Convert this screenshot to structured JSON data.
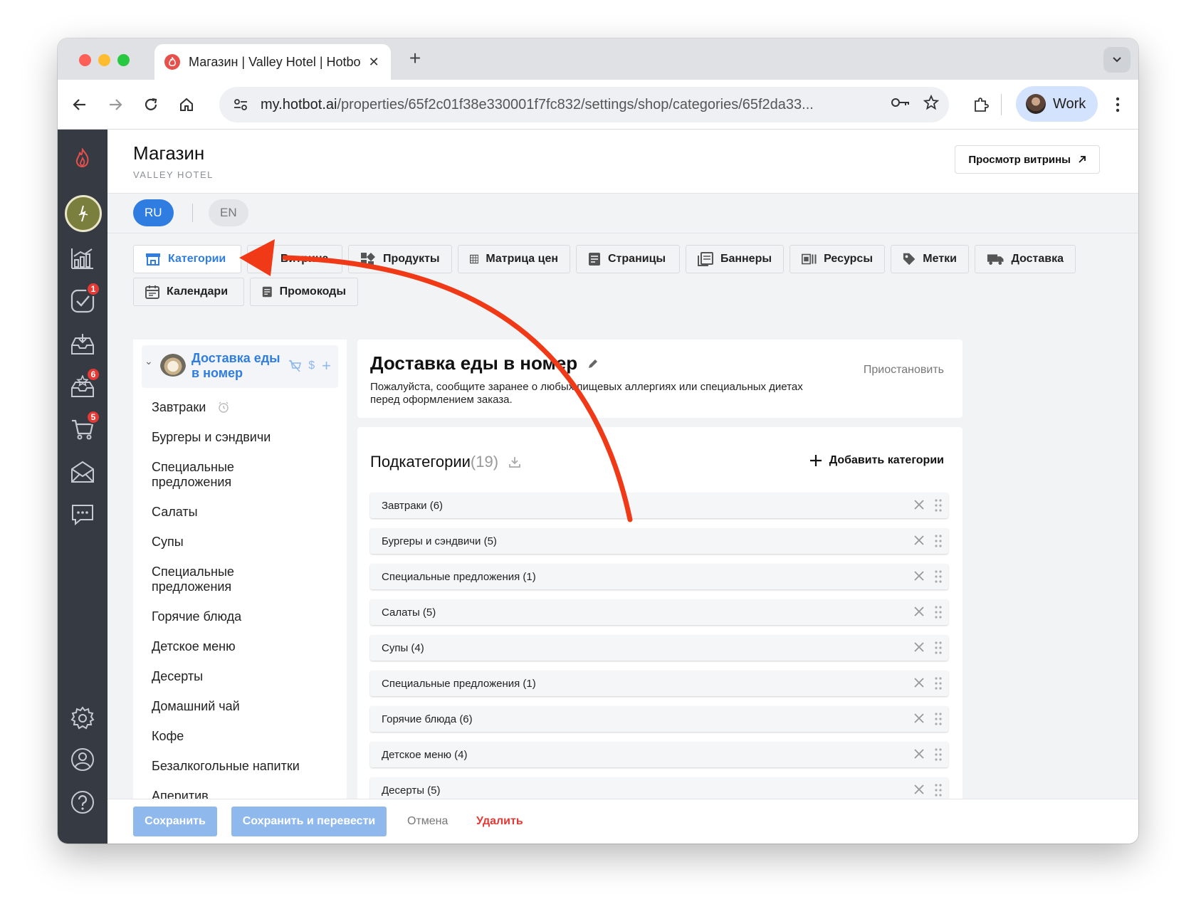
{
  "browser": {
    "tab_title": "Магазин | Valley Hotel | Hotbot",
    "url_host": "my.hotbot.ai",
    "url_path": "/properties/65f2c01f38e330001f7fc832/settings/shop/categories/65f2da33...",
    "profile_name": "Work"
  },
  "sidebar": {
    "badges": {
      "tasks": "1",
      "reviews": "6",
      "cart": "5"
    }
  },
  "header": {
    "title": "Магазин",
    "subtitle": "VALLEY HOTEL",
    "preview_label": "Просмотр витрины"
  },
  "languages": {
    "ru": "RU",
    "en": "EN"
  },
  "nav_tabs": [
    {
      "label": "Категории"
    },
    {
      "label": "Витрина"
    },
    {
      "label": "Продукты"
    },
    {
      "label": "Матрица цен"
    },
    {
      "label": "Страницы"
    },
    {
      "label": "Баннеры"
    },
    {
      "label": "Ресурсы"
    },
    {
      "label": "Метки"
    },
    {
      "label": "Доставка"
    },
    {
      "label": "Календари"
    },
    {
      "label": "Промокоды"
    }
  ],
  "tree": {
    "root_label": "Доставка еды в номер",
    "items": [
      "Завтраки",
      "Бургеры и сэндвичи",
      "Специальные предложения",
      "Салаты",
      "Супы",
      "Специальные предложения",
      "Горячие блюда",
      "Детское меню",
      "Десерты",
      "Домашний чай",
      "Кофе",
      "Безалкогольные напитки",
      "Аперитив"
    ]
  },
  "category": {
    "title": "Доставка еды в номер",
    "description": "Пожалуйста, сообщите заранее о любых пищевых аллергиях или специальных диетах перед оформлением заказа.",
    "pause_label": "Приостановить"
  },
  "subcategories": {
    "title": "Подкатегории",
    "count": "(19)",
    "add_label": "Добавить категории",
    "rows": [
      "Завтраки (6)",
      "Бургеры и сэндвичи (5)",
      "Специальные предложения (1)",
      "Салаты (5)",
      "Супы (4)",
      "Специальные предложения (1)",
      "Горячие блюда (6)",
      "Детское меню (4)",
      "Десерты (5)"
    ]
  },
  "footer": {
    "save": "Сохранить",
    "save_translate": "Сохранить и перевести",
    "cancel": "Отмена",
    "delete": "Удалить"
  },
  "colors": {
    "accent": "#2f7de1",
    "sidebar_bg": "#363a43",
    "badge": "#e53935",
    "delete": "#e53935",
    "annotation_arrow": "#f03a17"
  }
}
